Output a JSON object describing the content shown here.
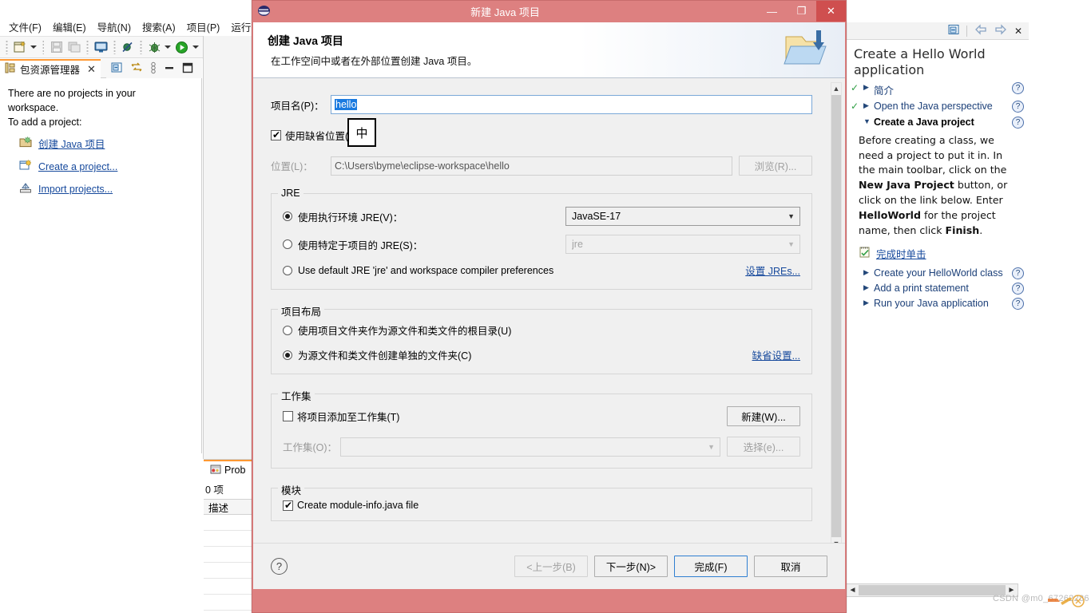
{
  "ide": {
    "menu": [
      {
        "label": "文件(F)"
      },
      {
        "label": "编辑(E)"
      },
      {
        "label": "导航(N)"
      },
      {
        "label": "搜索(A)"
      },
      {
        "label": "项目(P)"
      },
      {
        "label": "运行(R"
      }
    ],
    "explorer": {
      "tab_label": "包资源管理器",
      "empty_line1": "There are no projects in your",
      "empty_line2": "workspace.",
      "empty_line3": "To add a project:",
      "links": [
        {
          "label": "创建 Java 项目",
          "icon": "new-java-project-icon"
        },
        {
          "label": "Create a project...",
          "icon": "new-project-icon"
        },
        {
          "label": "Import projects...",
          "icon": "import-projects-icon"
        }
      ]
    },
    "problems": {
      "tab_label": "Prob",
      "count_label": "0 项",
      "column_header": "描述"
    }
  },
  "cheatsheet": {
    "title": "Create a Hello World application",
    "items": [
      {
        "label": "简介",
        "state": "done",
        "marker": "triangle-right",
        "help": "?"
      },
      {
        "label": "Open the Java perspective",
        "state": "done",
        "marker": "triangle-right",
        "help": "?"
      },
      {
        "label": "Create a Java project",
        "state": "active",
        "marker": "triangle-down",
        "help": "?"
      },
      {
        "label": "Create your HelloWorld class",
        "state": "todo",
        "marker": "triangle-right",
        "help": "?"
      },
      {
        "label": "Add a print statement",
        "state": "todo",
        "marker": "triangle-right",
        "help": "?"
      },
      {
        "label": "Run your Java application",
        "state": "todo",
        "marker": "triangle-right",
        "help": "?"
      }
    ],
    "body_html": "Before creating a class, we need a project to put it in. In the main toolbar, click on the <b>New Java Project</b> button, or click on the link below. Enter <b>HelloWorld</b> for the project name, then click <b>Finish</b>.",
    "action_label": "完成时单击",
    "toolbar_icons": [
      "collapse-icon",
      "back-arrow-icon",
      "forward-arrow-icon",
      "close-icon"
    ]
  },
  "dialog": {
    "window_title": "新建 Java 项目",
    "header_title": "创建 Java 项目",
    "header_subtitle": "在工作空间中或者在外部位置创建 Java 项目。",
    "project_name": {
      "label": "项目名(P)：",
      "value": "hello"
    },
    "default_location": {
      "label": "使用缺省位置(D)",
      "checked": true
    },
    "location": {
      "label": "位置(L)：",
      "value": "C:\\Users\\byme\\eclipse-workspace\\hello",
      "browse_label": "浏览(R)...",
      "enabled": false
    },
    "jre": {
      "group_title": "JRE",
      "option_execution_env": "使用执行环境 JRE(V)：",
      "execution_env_value": "JavaSE-17",
      "option_project_specific": "使用特定于项目的 JRE(S)：",
      "project_specific_value": "jre",
      "option_default_jre": "Use default JRE 'jre' and workspace compiler preferences",
      "selected": "execution_env",
      "configure_link": "设置 JREs..."
    },
    "layout": {
      "group_title": "项目布局",
      "option_project_folder": "使用项目文件夹作为源文件和类文件的根目录(U)",
      "option_separate_folders": "为源文件和类文件创建单独的文件夹(C)",
      "selected": "separate_folders",
      "configure_link": "缺省设置..."
    },
    "working_sets": {
      "group_title": "工作集",
      "add_checkbox": "将项目添加至工作集(T)",
      "add_checked": false,
      "new_button": "新建(W)...",
      "working_set_label": "工作集(O)：",
      "working_set_value": "",
      "select_button": "选择(e)..."
    },
    "module": {
      "group_title": "模块",
      "create_module_info": "Create module-info.java file",
      "checked": true
    },
    "footer": {
      "help_icon": "?",
      "back": "<上一步(B)",
      "next": "下一步(N)>",
      "finish": "完成(F)",
      "cancel": "取消"
    }
  },
  "ime_indicator": "中",
  "watermark": "CSDN @m0_67262286",
  "colors": {
    "dialog_titlebar": "#dd8080",
    "dialog_close": "#cf4f4f",
    "accent_link": "#16499c",
    "selection": "#1a7ae0",
    "tab_accent": "#ff9933",
    "cheat_heading": "#2b2b2b"
  }
}
